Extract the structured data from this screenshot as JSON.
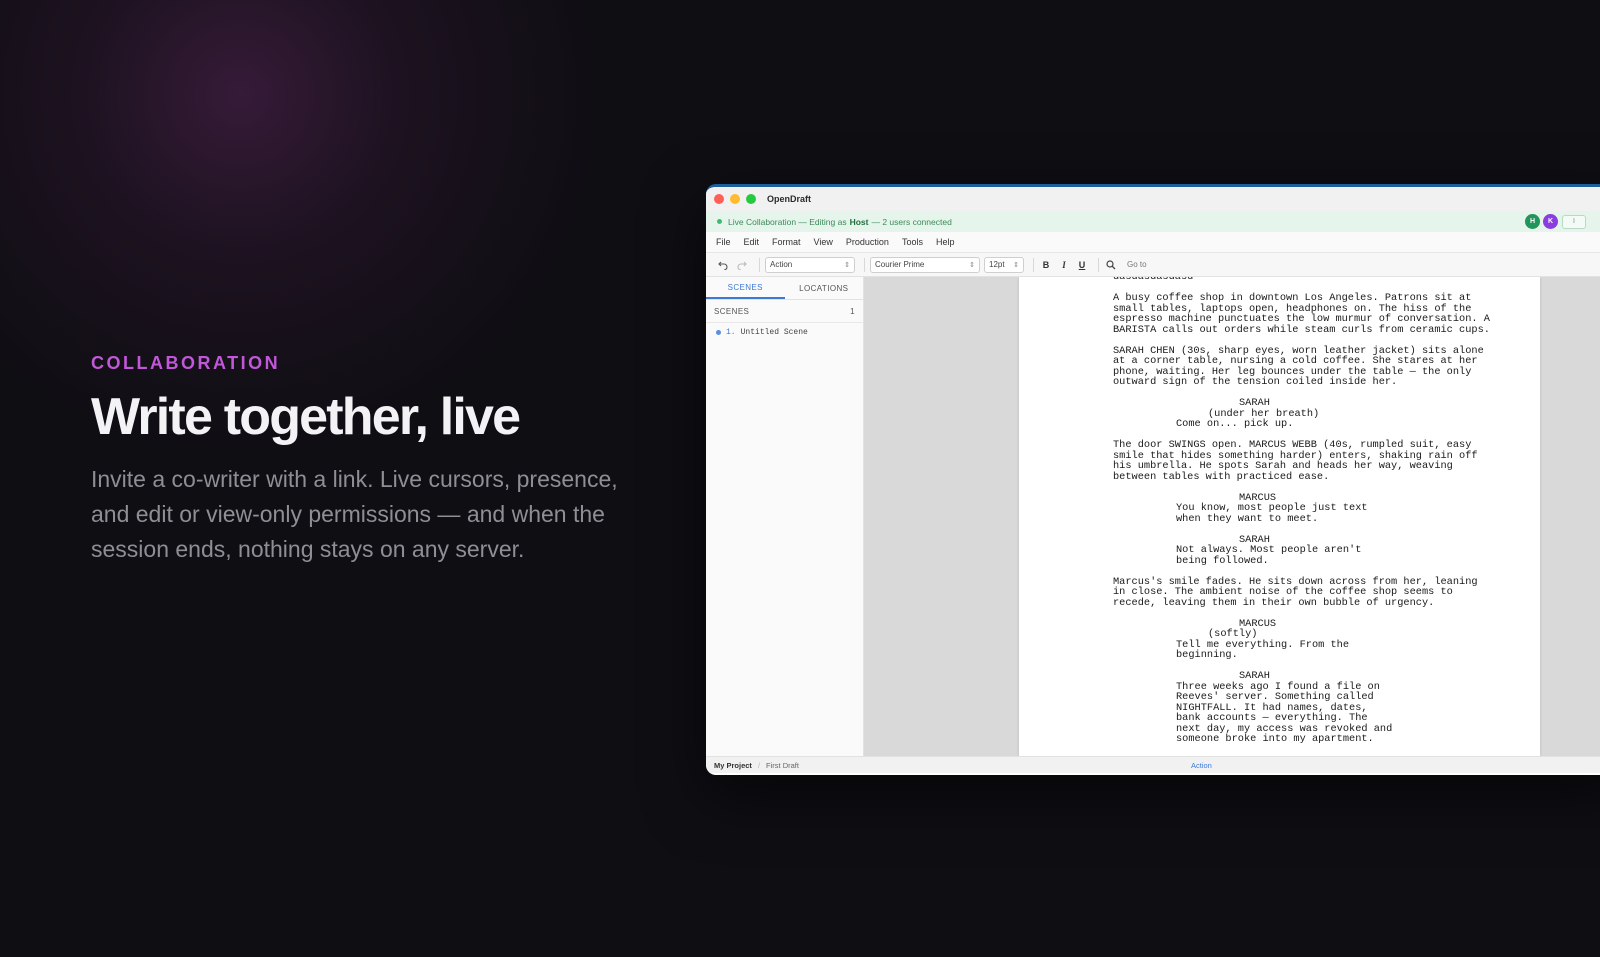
{
  "hero": {
    "eyebrow": "COLLABORATION",
    "headline": "Write together, live",
    "subhead": "Invite a co-writer with a link. Live cursors, presence, and edit or view-only permissions — and when the session ends, nothing stays on any server."
  },
  "window": {
    "title": "OpenDraft",
    "collab": {
      "prefix": "Live Collaboration — Editing as",
      "role": "Host",
      "suffix": "— 2 users connected",
      "avatars": [
        "H",
        "K"
      ],
      "button": "I"
    },
    "menu": [
      "File",
      "Edit",
      "Format",
      "View",
      "Production",
      "Tools",
      "Help"
    ],
    "toolbar": {
      "element_type": "Action",
      "font": "Courier Prime",
      "size": "12pt",
      "bold": "B",
      "italic": "I",
      "underline": "U",
      "goto": "Go to"
    },
    "sidebar": {
      "tabs": [
        "SCENES",
        "LOCATIONS"
      ],
      "scenes_label": "SCENES",
      "scene_count": "1",
      "scenes": [
        {
          "num": "1.",
          "name": "Untitled Scene"
        }
      ]
    },
    "script": {
      "top_fragment": "dasdasdasdasd",
      "blocks": [
        {
          "type": "action",
          "text": "A busy coffee shop in downtown Los Angeles. Patrons sit at\nsmall tables, laptops open, headphones on. The hiss of the\nespresso machine punctuates the low murmur of conversation. A\nBARISTA calls out orders while steam curls from ceramic cups."
        },
        {
          "type": "action",
          "text": "SARAH CHEN (30s, sharp eyes, worn leather jacket) sits alone\nat a corner table, nursing a cold coffee. She stares at her\nphone, waiting. Her leg bounces under the table — the only\noutward sign of the tension coiled inside her."
        },
        {
          "type": "character",
          "text": "SARAH"
        },
        {
          "type": "paren",
          "text": "(under her breath)"
        },
        {
          "type": "dialog",
          "text": "Come on... pick up."
        },
        {
          "type": "action",
          "text": "The door SWINGS open. MARCUS WEBB (40s, rumpled suit, easy\nsmile that hides something harder) enters, shaking rain off\nhis umbrella. He spots Sarah and heads her way, weaving\nbetween tables with practiced ease."
        },
        {
          "type": "character",
          "text": "MARCUS"
        },
        {
          "type": "dialog",
          "text": "You know, most people just text\nwhen they want to meet."
        },
        {
          "type": "character",
          "text": "SARAH"
        },
        {
          "type": "dialog",
          "text": "Not always. Most people aren't\nbeing followed."
        },
        {
          "type": "action",
          "text": "Marcus's smile fades. He sits down across from her, leaning\nin close. The ambient noise of the coffee shop seems to\nrecede, leaving them in their own bubble of urgency."
        },
        {
          "type": "character",
          "text": "MARCUS"
        },
        {
          "type": "paren",
          "text": "(softly)"
        },
        {
          "type": "dialog",
          "text": "Tell me everything. From the\nbeginning."
        },
        {
          "type": "character",
          "text": "SARAH"
        },
        {
          "type": "dialog",
          "text": "Three weeks ago I found a file on\nReeves' server. Something called\nNIGHTFALL. It had names, dates,\nbank accounts — everything. The\nnext day, my access was revoked and\nsomeone broke into my apartment."
        }
      ]
    },
    "status": {
      "project": "My Project",
      "draft": "First Draft",
      "element": "Action"
    }
  }
}
